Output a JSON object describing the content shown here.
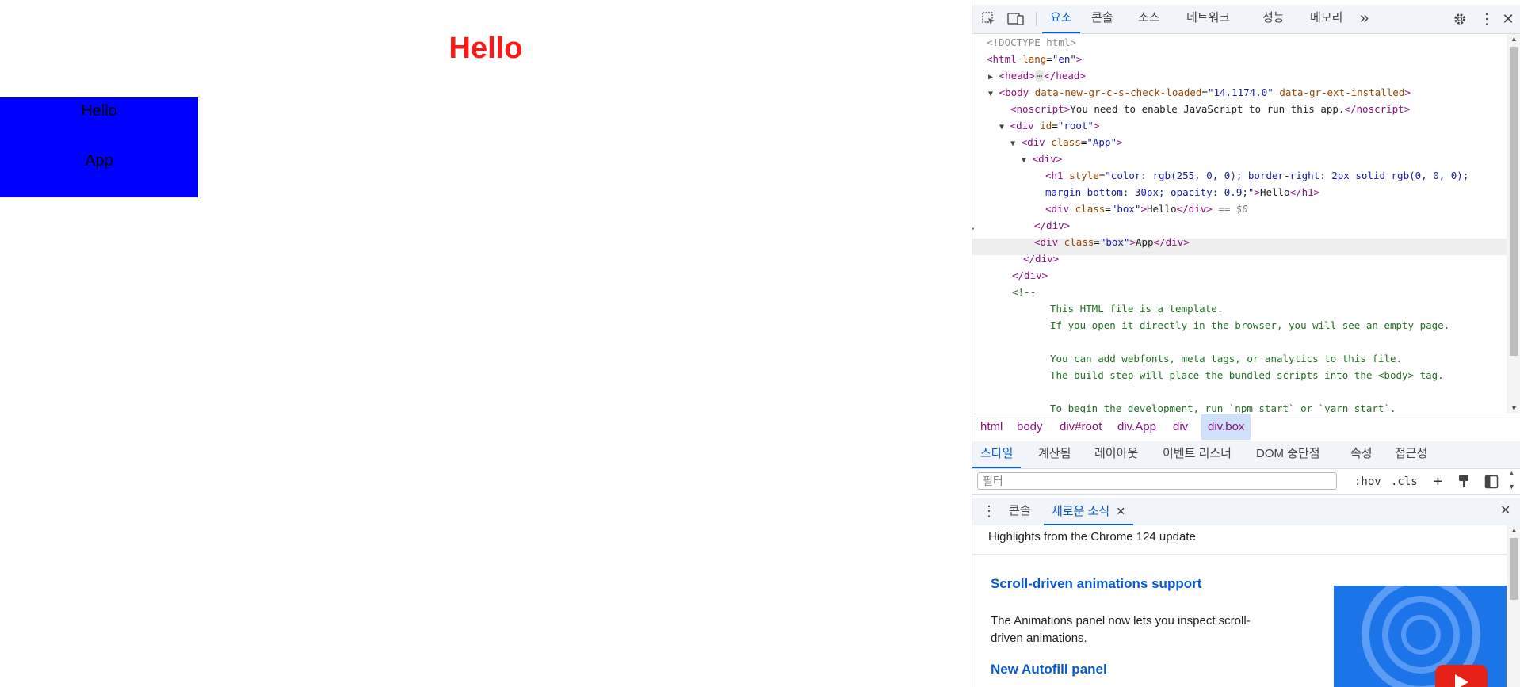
{
  "page": {
    "heading": "Hello",
    "boxes": [
      "Hello",
      "App"
    ]
  },
  "devtools": {
    "tabs": [
      "요소",
      "콘솔",
      "소스",
      "네트워크",
      "성능",
      "메모리"
    ],
    "more_tabs": "»",
    "dom": {
      "doctype": "<!DOCTYPE html>",
      "html_tag": "<html",
      "html_lang_attr": "lang",
      "html_lang_val": "\"en\"",
      "head_open": "<head>",
      "head_ellipsis": "⋯",
      "head_close": "</head>",
      "body_tag": "<body",
      "body_attr1": "data-new-gr-c-s-check-loaded",
      "body_val1": "\"14.1174.0\"",
      "body_attr2": "data-gr-ext-installed",
      "noscript_open": "<noscript>",
      "noscript_text": "You need to enable JavaScript to run this app.",
      "noscript_close": "</noscript>",
      "div_root_tag": "<div",
      "div_root_attr": "id",
      "div_root_val": "\"root\"",
      "div_app_tag": "<div",
      "div_app_attr": "class",
      "div_app_val": "\"App\"",
      "div_open": "<div>",
      "h1_tag": "<h1",
      "h1_attr": "style",
      "h1_style_line1": "\"color: rgb(255, 0, 0); border-right: 2px solid rgb(0, 0, 0);",
      "h1_style_line2": "margin-bottom: 30px; opacity: 0.9;\"",
      "h1_text": "Hello",
      "h1_close": "</h1>",
      "box_tag": "<div",
      "box_attr": "class",
      "box_val": "\"box\"",
      "box1_text": "Hello",
      "div_close": "</div>",
      "selected_marker": "== $0",
      "box2_text": "App",
      "comment_open": "<!--",
      "comment_lines": [
        "This HTML file is a template.",
        "If you open it directly in the browser, you will see an empty page.",
        "",
        "You can add webfonts, meta tags, or analytics to this file.",
        "The build step will place the bundled scripts into the <body> tag.",
        "",
        "To begin the development, run `npm start` or `yarn start`."
      ]
    },
    "breadcrumb": [
      "html",
      "body",
      "div#root",
      "div.App",
      "div",
      "div.box"
    ],
    "styles_tabs": [
      "스타일",
      "계산됨",
      "레이아웃",
      "이벤트 리스너",
      "DOM 중단점",
      "속성",
      "접근성"
    ],
    "filter": {
      "placeholder": "필터",
      "value": ""
    },
    "filter_tools": {
      "hov": ":hov",
      "cls": ".cls"
    },
    "drawer_tabs": [
      "콘솔",
      "새로운 소식"
    ],
    "news": {
      "highlight": "Highlights from the Chrome 124 update",
      "item1_title": "Scroll-driven animations support",
      "item1_desc": "The Animations panel now lets you inspect scroll-driven animations.",
      "item2_title": "New Autofill panel"
    },
    "colors": {
      "accent": "#0b57d0",
      "tag": "#881280",
      "attr": "#994500",
      "value": "#1a1aa6",
      "comment": "#236e25",
      "box_bg": "#0000ff",
      "heading": "#ff0000"
    }
  }
}
